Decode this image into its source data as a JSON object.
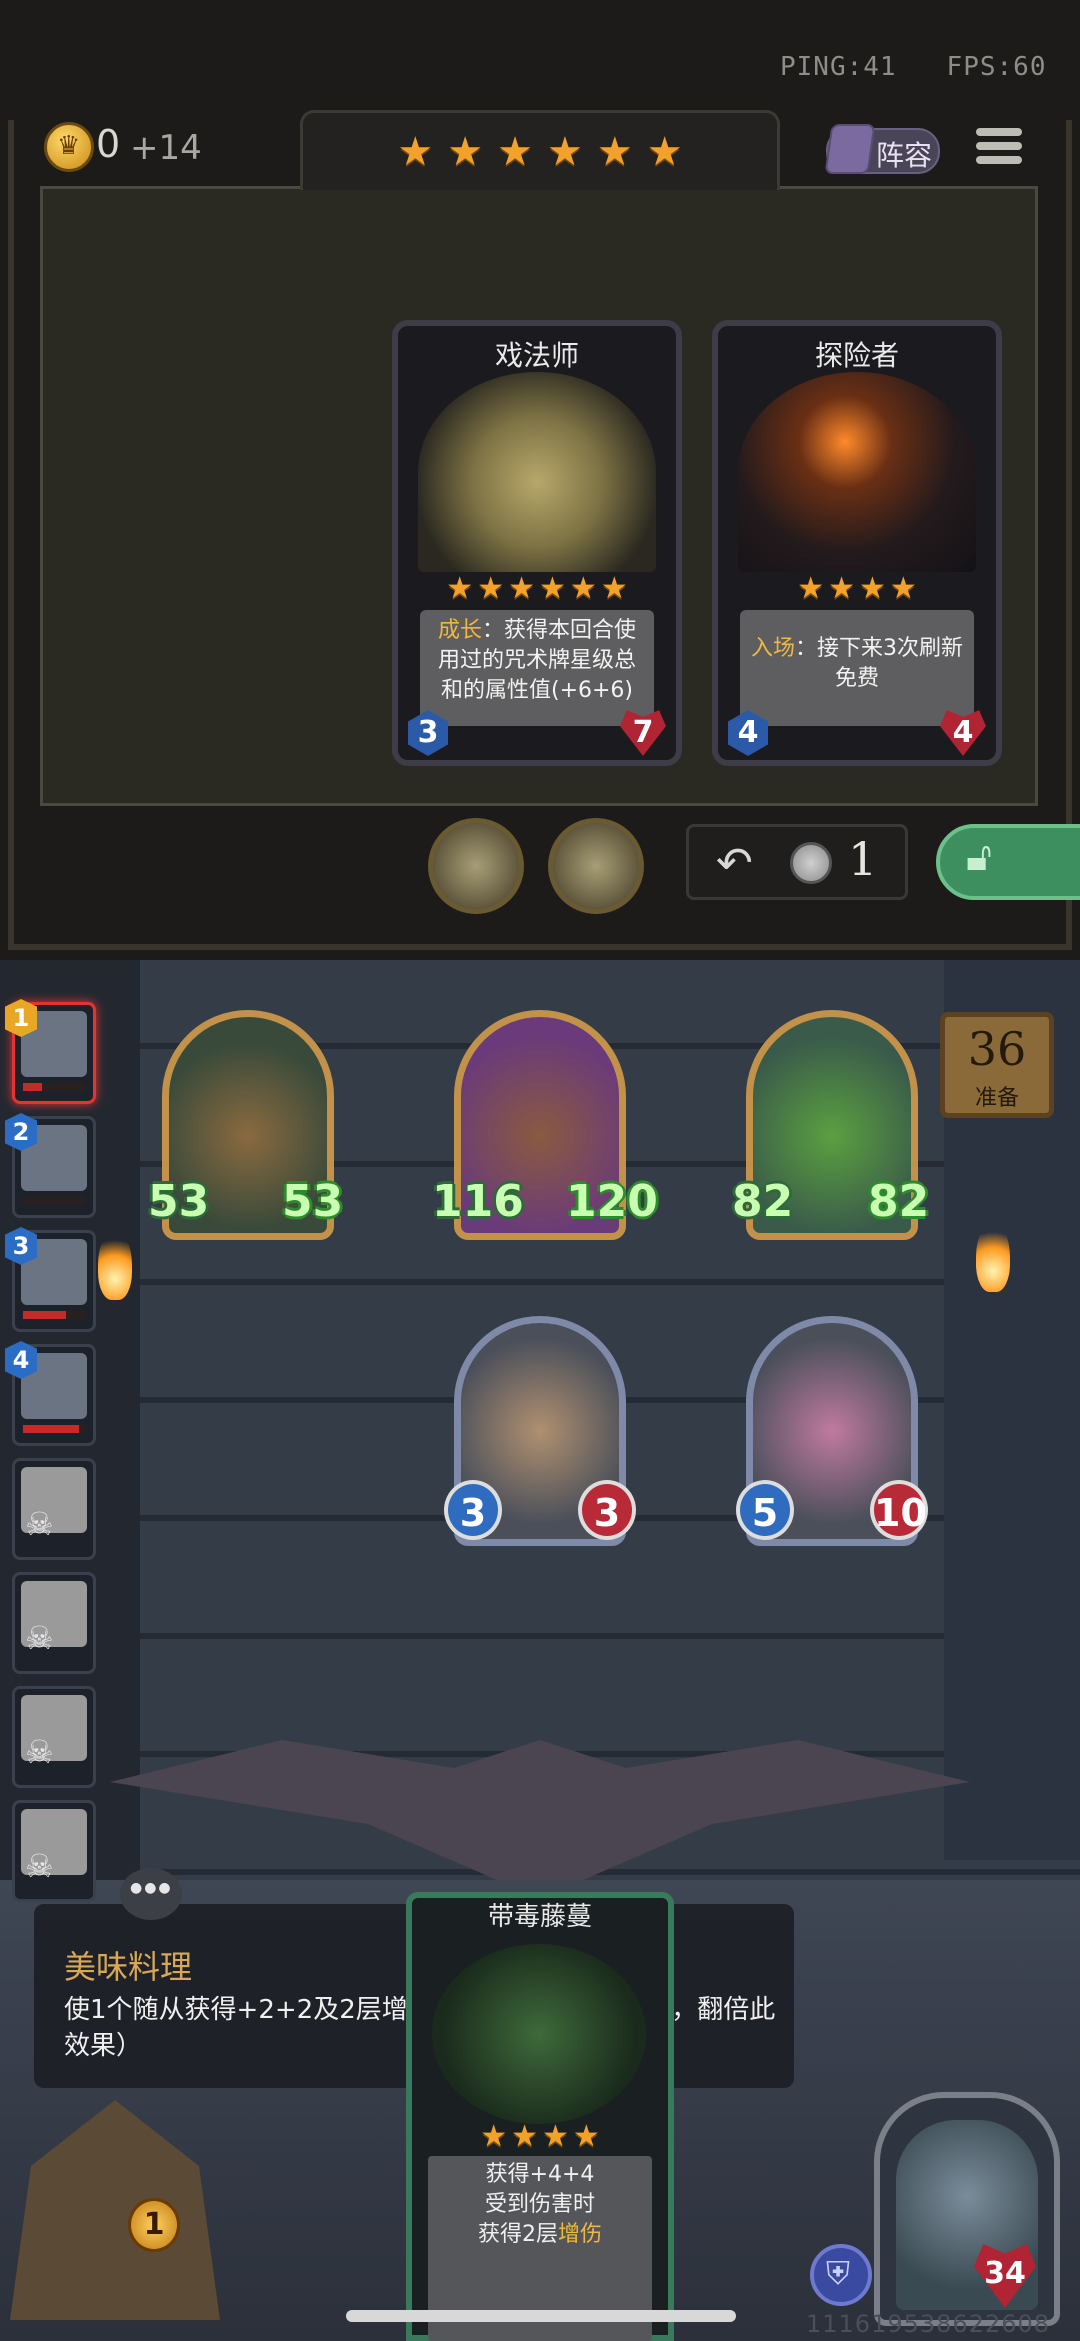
{
  "hud": {
    "ping": "PING:41",
    "fps": "FPS:60",
    "gold": "0",
    "gold_income": "+14",
    "lineup_label": "阵容",
    "shop_tier_stars": 6
  },
  "shop_cards": [
    {
      "name": "戏法师",
      "stars": 6,
      "keyword": "成长",
      "text": "：获得本回合使用过的咒术牌星级总和的属性值(+6+6)",
      "attack": "3",
      "health": "7"
    },
    {
      "name": "探险者",
      "stars": 4,
      "keyword": "入场",
      "text": "：接下来3次刷新免费",
      "attack": "4",
      "health": "4"
    }
  ],
  "shop_controls": {
    "refresh_cost": "1",
    "bonsai_count": 2
  },
  "players": [
    {
      "rank": "1",
      "health_fraction": 0.3,
      "active": true,
      "eliminated": false
    },
    {
      "rank": "2",
      "health_fraction": 0.0,
      "active": false,
      "eliminated": false
    },
    {
      "rank": "3",
      "health_fraction": 0.7,
      "active": false,
      "eliminated": false
    },
    {
      "rank": "4",
      "health_fraction": 0.9,
      "active": false,
      "eliminated": false
    },
    {
      "rank": "",
      "eliminated": true
    },
    {
      "rank": "",
      "eliminated": true
    },
    {
      "rank": "",
      "eliminated": true
    },
    {
      "rank": "",
      "eliminated": true
    }
  ],
  "ready": {
    "timer": "36",
    "label": "准备"
  },
  "board_minions": [
    {
      "atk": "53",
      "hp": "53"
    },
    {
      "atk": "116",
      "hp": "120"
    },
    {
      "atk": "82",
      "hp": "82"
    },
    {
      "atk": "3",
      "hp": "3"
    },
    {
      "atk": "5",
      "hp": "10"
    }
  ],
  "tooltip": {
    "title": "美味料理",
    "body": "使1个随从获得+2+2及2层增伤。（商店升级到6星后，翻倍此效果）"
  },
  "hand_card": {
    "name": "带毒藤蔓",
    "stars": 4,
    "line1": "获得+4+4",
    "line2": "受到伤害时",
    "line3_prefix": "获得2层",
    "line3_keyword": "增伤"
  },
  "chest_coins": "1",
  "hero": {
    "health": "34"
  },
  "uid": "111619538622608",
  "colors": {
    "star": "#f2a22a",
    "keyword": "#f0b840",
    "attack_blue": "#2b5aa8",
    "health_red": "#b02433",
    "lock_green": "#3e8f60"
  }
}
